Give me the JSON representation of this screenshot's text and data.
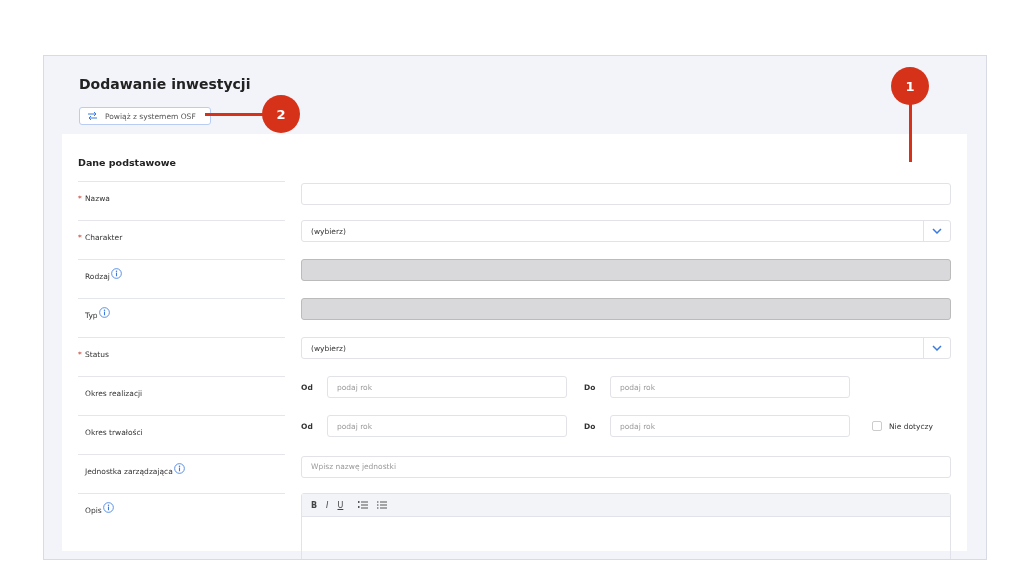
{
  "title": "Dodawanie inwestycji",
  "link_button": {
    "label": "Powiąż z systemem OSF"
  },
  "section": {
    "title": "Dane podstawowe",
    "fields": [
      {
        "kind": "text",
        "marker": "*",
        "label": "Nazwa",
        "info": false
      },
      {
        "kind": "select",
        "marker": "*",
        "label": "Charakter",
        "info": false,
        "value": "(wybierz)"
      },
      {
        "kind": "disabled",
        "label": "Rodzaj",
        "info": true
      },
      {
        "kind": "disabled",
        "label": "Typ",
        "info": true
      },
      {
        "kind": "select",
        "marker": "*",
        "label": "Status",
        "info": false,
        "value": "(wybierz)"
      },
      {
        "kind": "range",
        "label": "Okres realizacji",
        "info": false,
        "from_label": "Od",
        "from_placeholder": "podaj rok",
        "to_label": "Do",
        "to_placeholder": "podaj rok"
      },
      {
        "kind": "range",
        "label": "Okres trwałości",
        "info": false,
        "from_label": "Od",
        "from_placeholder": "podaj rok",
        "to_label": "Do",
        "to_placeholder": "podaj rok",
        "not_applicable": {
          "label": "Nie dotyczy",
          "checked": false
        }
      },
      {
        "kind": "text",
        "label": "Jednostka zarządzająca",
        "info": true,
        "placeholder": "Wpisz nazwę jednostki"
      },
      {
        "kind": "editor",
        "label": "Opis",
        "info": true,
        "tools": [
          "B",
          "I",
          "U"
        ]
      }
    ]
  },
  "callouts": [
    {
      "number": "1"
    },
    {
      "number": "2"
    }
  ]
}
